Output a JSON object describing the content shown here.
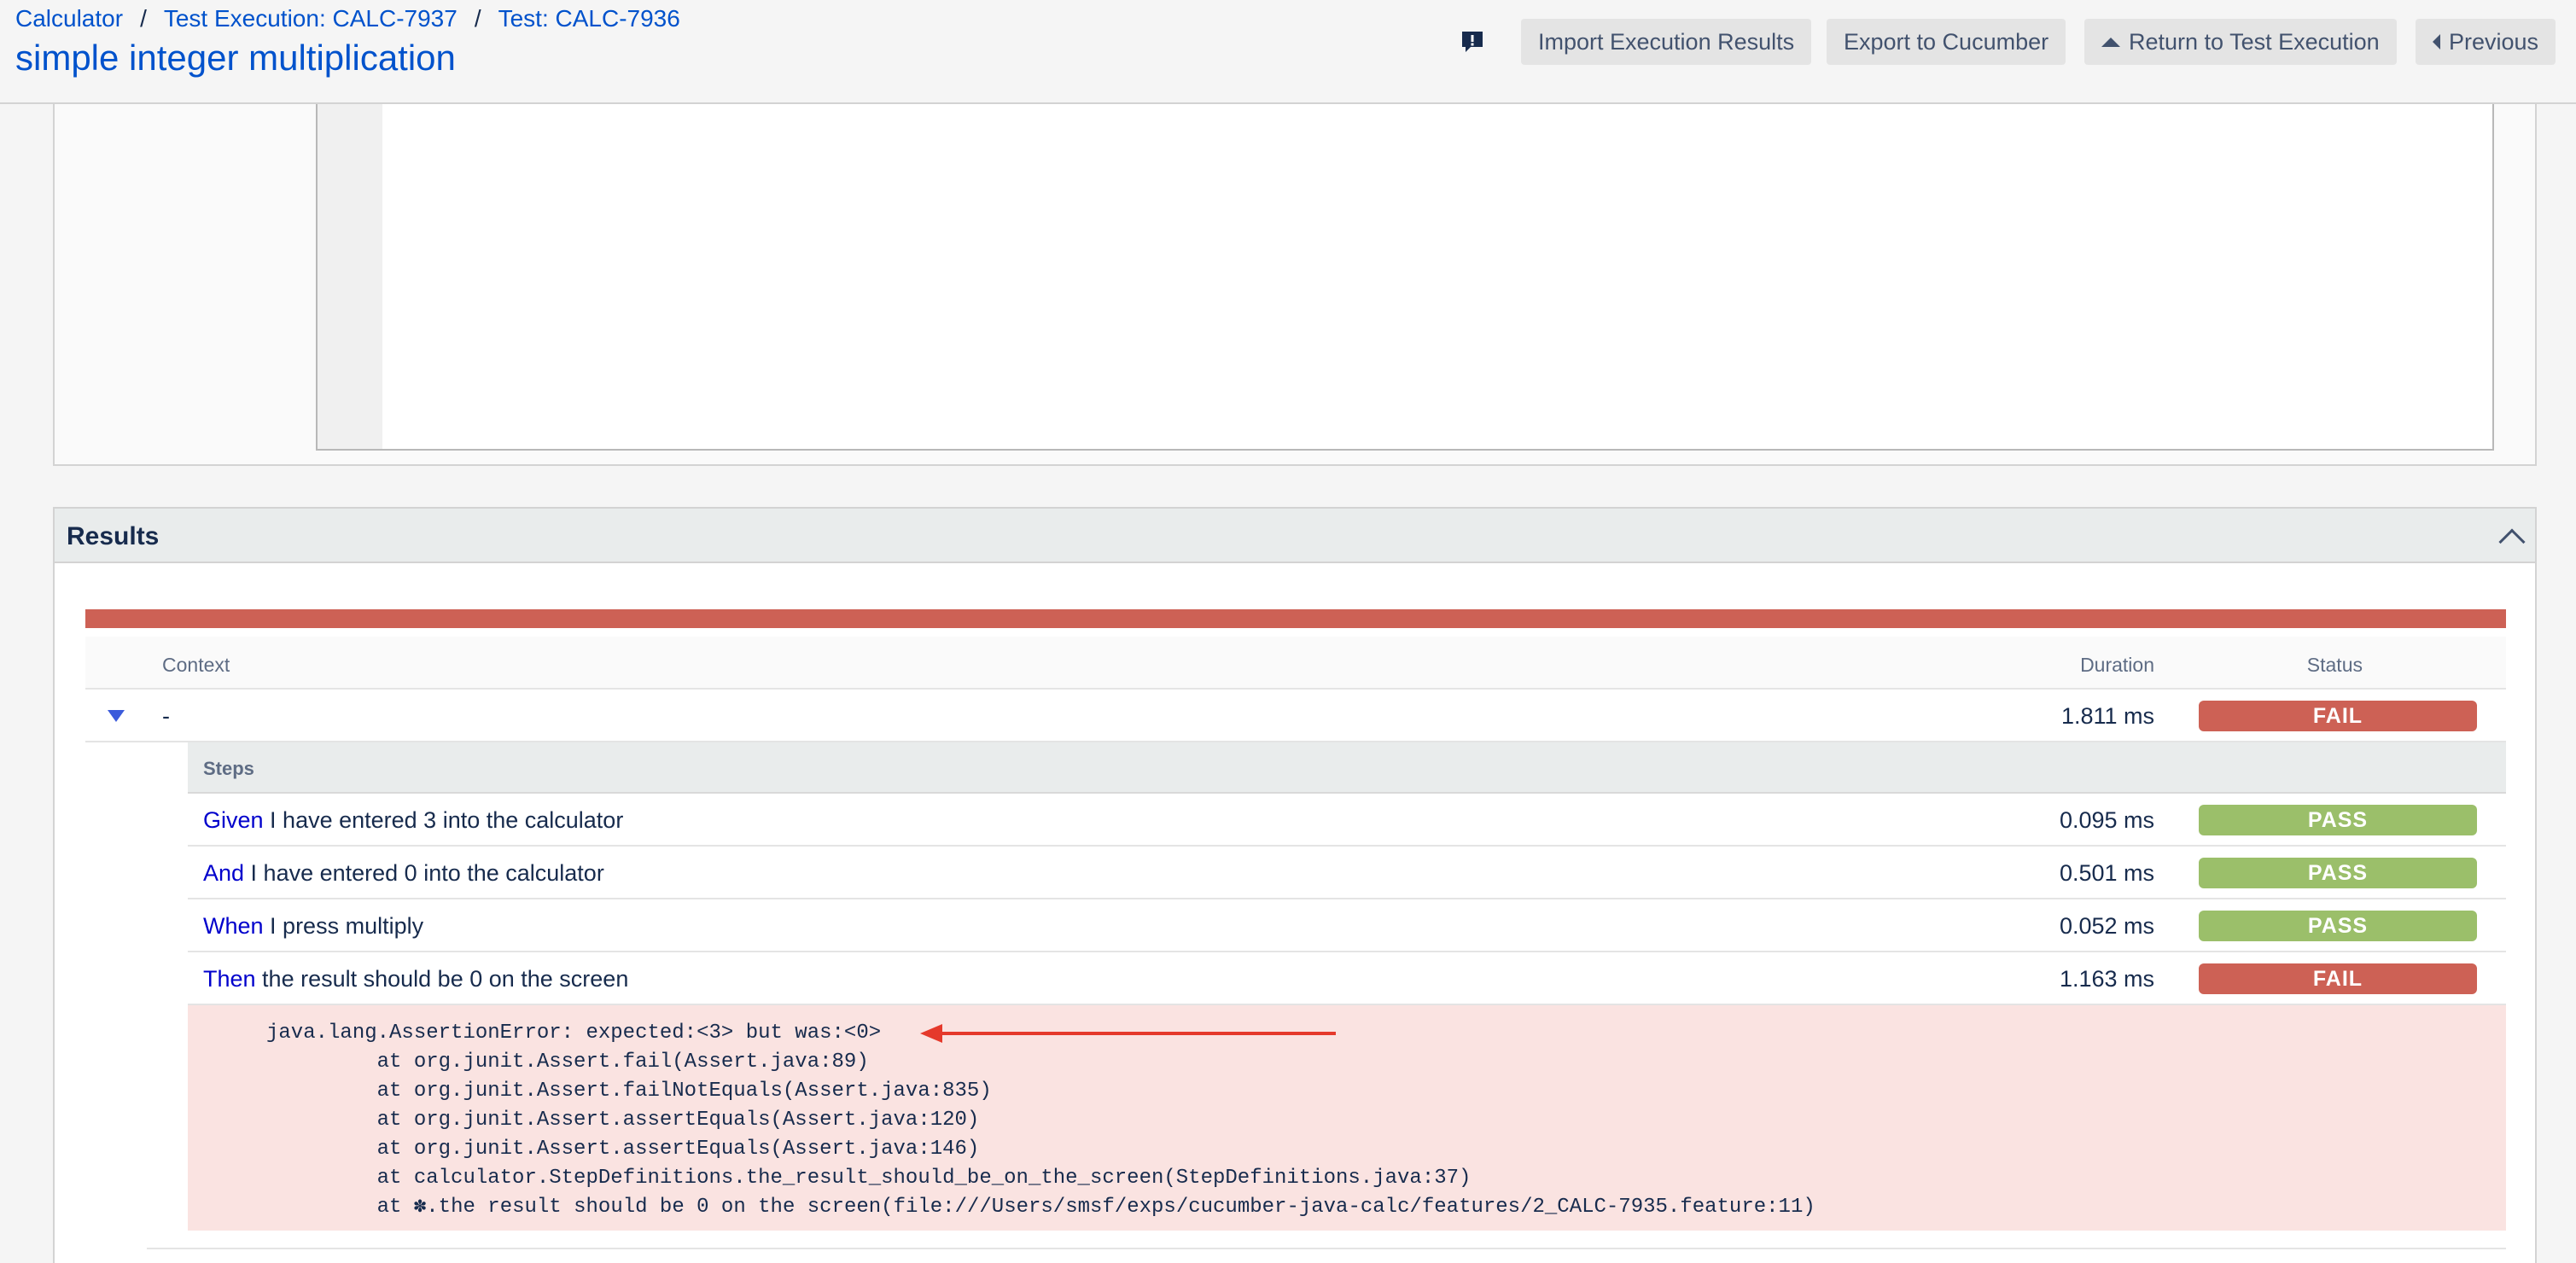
{
  "breadcrumb": {
    "project": "Calculator",
    "separator": "/",
    "execution": "Test Execution: CALC-7937",
    "test": "Test: CALC-7936"
  },
  "page_title": "simple integer multiplication",
  "header_buttons": {
    "import": "Import Execution Results",
    "export": "Export to Cucumber",
    "return": "Return to Test Execution",
    "previous": "Previous"
  },
  "results": {
    "title": "Results",
    "columns": {
      "context": "Context",
      "duration": "Duration",
      "status": "Status"
    },
    "context_row": {
      "name": "-",
      "duration": "1.811 ms",
      "status": "FAIL"
    },
    "steps_label": "Steps",
    "steps": [
      {
        "keyword": "Given",
        "text": " I have entered 3 into the calculator",
        "duration": "0.095 ms",
        "status": "PASS"
      },
      {
        "keyword": "And",
        "text": " I have entered 0 into the calculator",
        "duration": "0.501 ms",
        "status": "PASS"
      },
      {
        "keyword": "When",
        "text": " I press multiply",
        "duration": "0.052 ms",
        "status": "PASS"
      },
      {
        "keyword": "Then",
        "text": " the result should be 0 on the screen",
        "duration": "1.163 ms",
        "status": "FAIL"
      }
    ],
    "error_trace": "java.lang.AssertionError: expected:<3> but was:<0>\n         at org.junit.Assert.fail(Assert.java:89)\n         at org.junit.Assert.failNotEquals(Assert.java:835)\n         at org.junit.Assert.assertEquals(Assert.java:120)\n         at org.junit.Assert.assertEquals(Assert.java:146)\n         at calculator.StepDefinitions.the_result_should_be_on_the_screen(StepDefinitions.java:37)\n         at ✽.the result should be 0 on the screen(file:///Users/smsf/exps/cucumber-java-calc/features/2_CALC-7935.feature:11)"
  },
  "colors": {
    "fail": "#cd6155",
    "pass": "#9bbf6a",
    "link": "#0052cc",
    "error_bg": "#fae3e1",
    "annotation_arrow": "#e5392b"
  }
}
